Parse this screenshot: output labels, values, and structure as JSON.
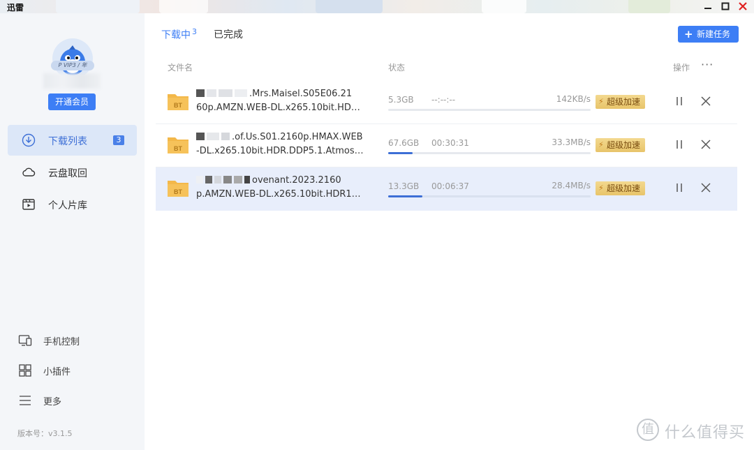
{
  "window": {
    "title": "迅雷"
  },
  "user": {
    "vip_tag": "P VIP3 / 年",
    "member_button": "开通会员"
  },
  "sidebar": {
    "items": [
      {
        "label": "下载列表",
        "badge": "3",
        "icon": "download-circle-icon",
        "active": true
      },
      {
        "label": "云盘取回",
        "icon": "cloud-icon",
        "active": false
      },
      {
        "label": "个人片库",
        "icon": "film-library-icon",
        "active": false
      }
    ],
    "tools": [
      {
        "label": "手机控制",
        "icon": "phone-control-icon"
      },
      {
        "label": "小插件",
        "icon": "plugin-grid-icon"
      },
      {
        "label": "更多",
        "icon": "menu-icon"
      }
    ],
    "version": "版本号：v3.1.5"
  },
  "tabs": [
    {
      "label": "下载中",
      "count": "3",
      "active": true
    },
    {
      "label": "已完成",
      "active": false
    }
  ],
  "new_task_button": "新建任务",
  "columns": {
    "filename": "文件名",
    "status": "状态",
    "actions": "操作"
  },
  "accel_label": "超级加速",
  "downloads": [
    {
      "name_line1": ".Mrs.Maisel.S05E06.21",
      "name_line2": "60p.AMZN.WEB-DL.x265.10bit.HD…",
      "size": "5.3GB",
      "eta": "--:--:--",
      "speed": "142KB/s",
      "progress": 0.0
    },
    {
      "name_line1": ".of.Us.S01.2160p.HMAX.WEB",
      "name_line2": "-DL.x265.10bit.HDR.DDP5.1.Atmos…",
      "size": "67.6GB",
      "eta": "00:30:31",
      "speed": "33.3MB/s",
      "progress": 0.12
    },
    {
      "name_line1": "ovenant.2023.2160",
      "name_line2": "p.AMZN.WEB-DL.x265.10bit.HDR1…",
      "size": "13.3GB",
      "eta": "00:06:37",
      "speed": "28.4MB/s",
      "progress": 0.17
    }
  ],
  "watermark": "什么值得买"
}
